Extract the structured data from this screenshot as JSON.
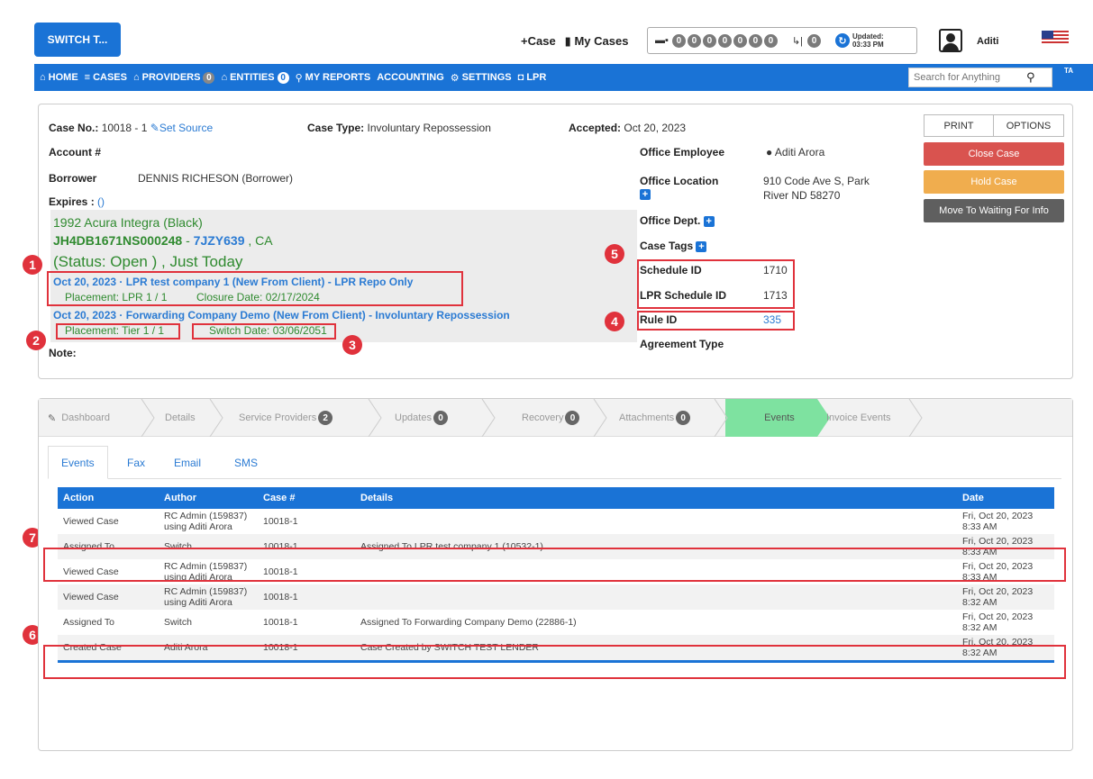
{
  "header": {
    "app_button": "SWITCH T...",
    "case_link": "+Case",
    "my_cases_link": "My Cases",
    "counter_digits": [
      "0",
      "0",
      "0",
      "0",
      "0",
      "0",
      "0"
    ],
    "phone_count": "0",
    "updated_label": "Updated:",
    "updated_time": "03:33 PM",
    "username": "Aditi"
  },
  "nav": {
    "home": "HOME",
    "cases": "CASES",
    "providers": "PROVIDERS",
    "providers_count": "0",
    "entities": "ENTITIES",
    "entities_count": "0",
    "my_reports": "MY REPORTS",
    "accounting": "ACCOUNTING",
    "settings": "SETTINGS",
    "lpr": "LPR",
    "search_placeholder": "Search for Anything",
    "tail": "TA"
  },
  "case": {
    "case_no_label": "Case No.:",
    "case_no": "10018 - 1",
    "set_source": "Set Source",
    "case_type_label": "Case Type:",
    "case_type": "Involuntary Repossession",
    "accepted_label": "Accepted:",
    "accepted": "Oct 20, 2023",
    "account_label": "Account #",
    "borrower_label": "Borrower",
    "borrower": "DENNIS RICHESON (Borrower)",
    "expires_label": "Expires :",
    "expires_value": "()",
    "vehicle": "1992 Acura Integra (Black)",
    "vin": "JH4DB1671NS000248",
    "vin_sep": " - ",
    "plate": "7JZY639",
    "state": " , CA",
    "status": "(Status: Open ) , Just Today",
    "assignment1_title": "Oct 20, 2023 · LPR test company 1 (New From Client) - LPR Repo Only",
    "assignment1_placement": "Placement: LPR 1 / 1",
    "assignment1_closure": "Closure Date: 02/17/2024",
    "assignment2_title": "Oct 20, 2023 · Forwarding Company Demo (New From Client) - Involuntary Repossession",
    "assignment2_placement": "Placement: Tier 1 / 1",
    "assignment2_switch": "Switch Date: 03/06/2051",
    "note_label": "Note:",
    "office_employee_label": "Office Employee",
    "office_employee": "● Aditi Arora",
    "office_location_label": "Office Location",
    "office_location_line1": "910 Code Ave S, Park",
    "office_location_line2": "River ND 58270",
    "office_dept_label": "Office Dept.",
    "case_tags_label": "Case Tags",
    "schedule_id_label": "Schedule ID",
    "schedule_id": "1710",
    "lpr_schedule_id_label": "LPR Schedule ID",
    "lpr_schedule_id": "1713",
    "rule_id_label": "Rule ID",
    "rule_id": "335",
    "agreement_type_label": "Agreement Type"
  },
  "actions": {
    "print": "PRINT",
    "options": "OPTIONS",
    "close_case": "Close Case",
    "hold_case": "Hold Case",
    "move_waiting": "Move To Waiting For Info"
  },
  "callouts": [
    "1",
    "2",
    "3",
    "4",
    "5",
    "6",
    "7"
  ],
  "steps": [
    {
      "label": "Dashboard",
      "badge": ""
    },
    {
      "label": "Details",
      "badge": ""
    },
    {
      "label": "Service Providers",
      "badge": "2"
    },
    {
      "label": "Updates",
      "badge": "0"
    },
    {
      "label": "Recovery",
      "badge": "0"
    },
    {
      "label": "Attachments",
      "badge": "0"
    },
    {
      "label": "Events",
      "badge": ""
    },
    {
      "label": "Invoice Events",
      "badge": ""
    }
  ],
  "subtabs": [
    "Events",
    "Fax",
    "Email",
    "SMS"
  ],
  "events": {
    "columns": [
      "Action",
      "Author",
      "Case #",
      "Details",
      "Date"
    ],
    "rows": [
      {
        "action": "Viewed Case",
        "author1": "RC Admin (159837)",
        "author2": "using Aditi Arora",
        "case": "10018-1",
        "details": "",
        "date1": "Fri, Oct 20, 2023",
        "date2": "8:33 AM"
      },
      {
        "action": "Assigned To",
        "author1": "Switch",
        "author2": "",
        "case": "10018-1",
        "details": "Assigned To LPR test company 1 (10532-1)",
        "date1": "Fri, Oct 20, 2023",
        "date2": "8:33 AM"
      },
      {
        "action": "Viewed Case",
        "author1": "RC Admin (159837)",
        "author2": "using Aditi Arora",
        "case": "10018-1",
        "details": "",
        "date1": "Fri, Oct 20, 2023",
        "date2": "8:33 AM"
      },
      {
        "action": "Viewed Case",
        "author1": "RC Admin (159837)",
        "author2": "using Aditi Arora",
        "case": "10018-1",
        "details": "",
        "date1": "Fri, Oct 20, 2023",
        "date2": "8:32 AM"
      },
      {
        "action": "Assigned To",
        "author1": "Switch",
        "author2": "",
        "case": "10018-1",
        "details": "Assigned To Forwarding Company Demo (22886-1)",
        "date1": "Fri, Oct 20, 2023",
        "date2": "8:32 AM"
      },
      {
        "action": "Created Case",
        "author1": "Aditi Arora",
        "author2": "",
        "case": "10018-1",
        "details": "Case Created by SWITCH TEST LENDER",
        "date1": "Fri, Oct 20, 2023",
        "date2": "8:32 AM"
      }
    ]
  },
  "colors": {
    "brand_blue": "#1a73d6",
    "close_red": "#d9534f",
    "hold_orange": "#f0ad4e",
    "waiting_gray": "#5f5f5f",
    "callout_red": "#e0323c",
    "active_step_green": "#7ee2a0"
  }
}
